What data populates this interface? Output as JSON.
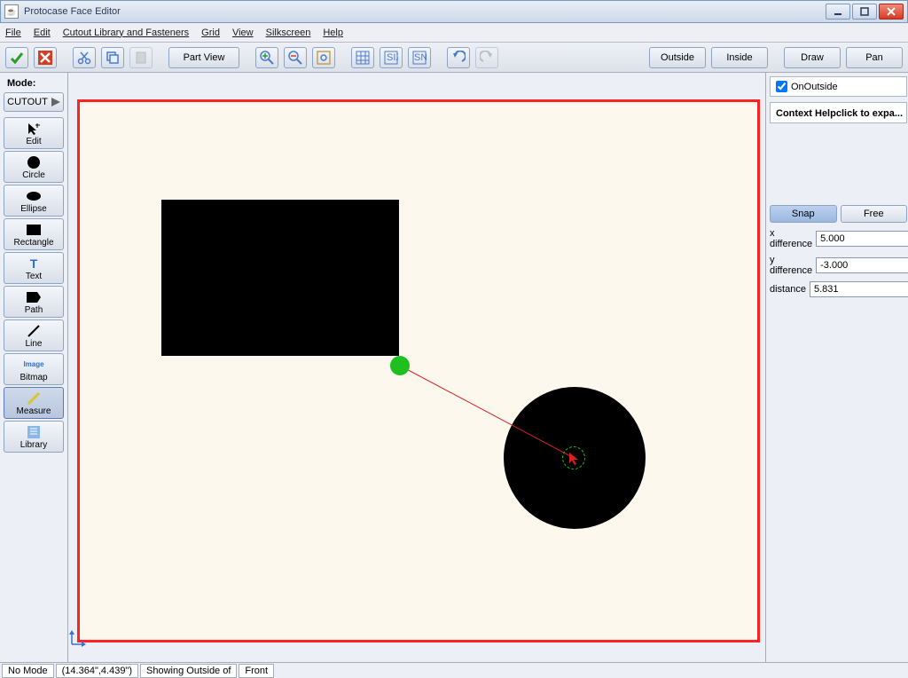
{
  "window": {
    "title": "Protocase Face Editor"
  },
  "menu": {
    "file": "File",
    "edit": "Edit",
    "cutout": "Cutout Library and Fasteners",
    "grid": "Grid",
    "view": "View",
    "silkscreen": "Silkscreen",
    "help": "Help"
  },
  "toolbar": {
    "partview": "Part View",
    "outside": "Outside",
    "inside": "Inside",
    "draw": "Draw",
    "pan": "Pan"
  },
  "mode": {
    "header": "Mode:",
    "cutout": "CUTOUT",
    "tools": {
      "edit": "Edit",
      "circle": "Circle",
      "ellipse": "Ellipse",
      "rectangle": "Rectangle",
      "text": "Text",
      "path": "Path",
      "line": "Line",
      "bitmap": "Bitmap",
      "measure": "Measure",
      "library": "Library"
    }
  },
  "right": {
    "onoutside": "OnOutside",
    "contexthelp": "Context Helpclick to expa...",
    "snap": "Snap",
    "free": "Free",
    "xdiff_label": "x difference",
    "xdiff": "5.000",
    "ydiff_label": "y difference",
    "ydiff": "-3.000",
    "dist_label": "distance",
    "dist": "5.831"
  },
  "status": {
    "mode": "No Mode",
    "coords": "(14.364\",4.439\")",
    "showing": "Showing Outside of",
    "face": "Front"
  }
}
